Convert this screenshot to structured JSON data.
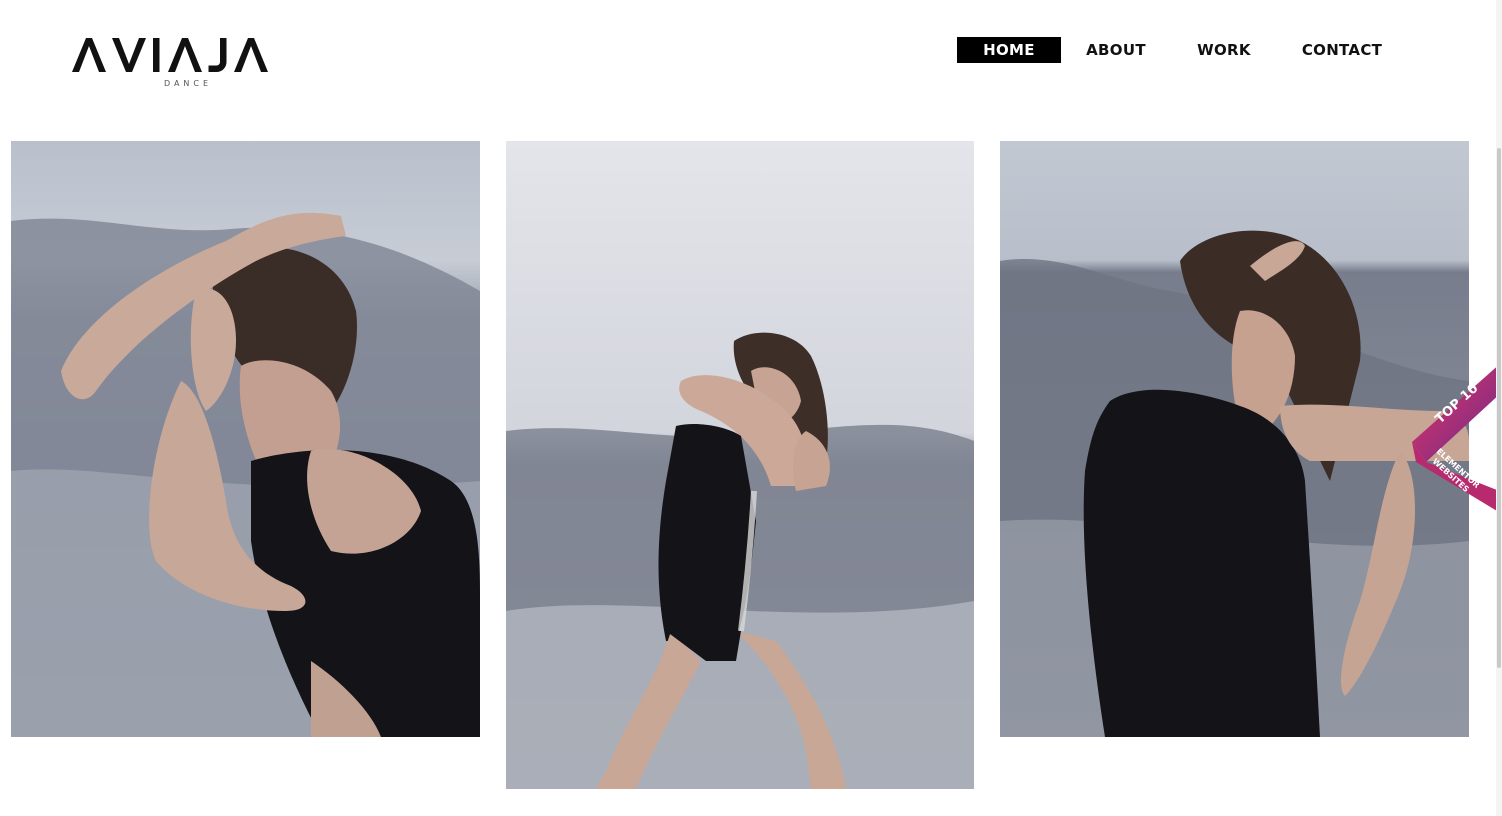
{
  "brand": {
    "name": "AVIAJA",
    "subtitle": "DANCE"
  },
  "nav": {
    "items": [
      {
        "label": "HOME",
        "active": true
      },
      {
        "label": "ABOUT",
        "active": false
      },
      {
        "label": "WORK",
        "active": false
      },
      {
        "label": "CONTACT",
        "active": false
      }
    ]
  },
  "gallery": {
    "photos": [
      {
        "name": "dancer-photo-hands-on-head"
      },
      {
        "name": "dancer-photo-pouring-sand"
      },
      {
        "name": "dancer-photo-arching-back"
      }
    ]
  },
  "badge": {
    "line1": "TOP 10",
    "line2a": "ELEMENTOR",
    "line2b": "WEBSITES",
    "colors": {
      "start": "#e8355f",
      "end": "#6a2a8f"
    }
  },
  "colors": {
    "nav_active_bg": "#000000",
    "nav_active_text": "#ffffff",
    "text": "#111111"
  }
}
